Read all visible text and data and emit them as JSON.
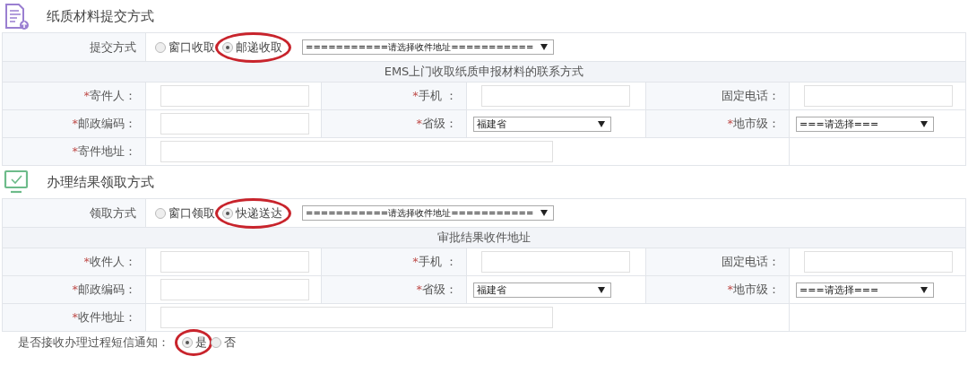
{
  "sections": [
    {
      "title": "纸质材料提交方式",
      "kind": "document",
      "method": {
        "label": "提交方式",
        "options": [
          {
            "label": "窗口收取",
            "selected": false,
            "circled": false
          },
          {
            "label": "邮递收取",
            "selected": true,
            "circled": true
          }
        ],
        "select": "===========请选择收件地址==========="
      },
      "subtitle": "EMS上门收取纸质申报材料的联系方式",
      "rows": [
        [
          {
            "mark": "*",
            "label": "寄件人：",
            "kind": "input"
          },
          {
            "mark": "*",
            "label": "手机 ：",
            "kind": "input"
          },
          {
            "label": "固定电话：",
            "kind": "input"
          }
        ],
        [
          {
            "mark": "*",
            "label": "邮政编码：",
            "kind": "input"
          },
          {
            "mark": "*",
            "label": "省级：",
            "kind": "select",
            "value": "福建省"
          },
          {
            "mark": "*",
            "label": "地市级：",
            "kind": "select",
            "value": "===请选择==="
          }
        ]
      ],
      "address": {
        "mark": "*",
        "label": "寄件地址："
      }
    },
    {
      "title": "办理结果领取方式",
      "kind": "monitor",
      "method": {
        "label": "领取方式",
        "options": [
          {
            "label": "窗口领取",
            "selected": false,
            "circled": false
          },
          {
            "label": "快递送达",
            "selected": true,
            "circled": true
          }
        ],
        "select": "===========请选择收件地址==========="
      },
      "subtitle": "审批结果收件地址",
      "rows": [
        [
          {
            "mark": "*",
            "label": "收件人：",
            "kind": "input"
          },
          {
            "mark": "*",
            "label": "手机 ：",
            "kind": "input"
          },
          {
            "label": "固定电话：",
            "kind": "input"
          }
        ],
        [
          {
            "mark": "*",
            "label": "邮政编码：",
            "kind": "input"
          },
          {
            "mark": "*",
            "label": "省级：",
            "kind": "select",
            "value": "福建省"
          },
          {
            "mark": "*",
            "label": "地市级：",
            "kind": "select",
            "value": "===请选择==="
          }
        ]
      ],
      "address": {
        "mark": "*",
        "label": "收件地址："
      }
    }
  ],
  "sms": {
    "label": "是否接收办理过程短信通知：",
    "options": [
      {
        "label": "是",
        "selected": true,
        "circled": true
      },
      {
        "label": "否",
        "selected": false,
        "circled": false
      }
    ]
  }
}
